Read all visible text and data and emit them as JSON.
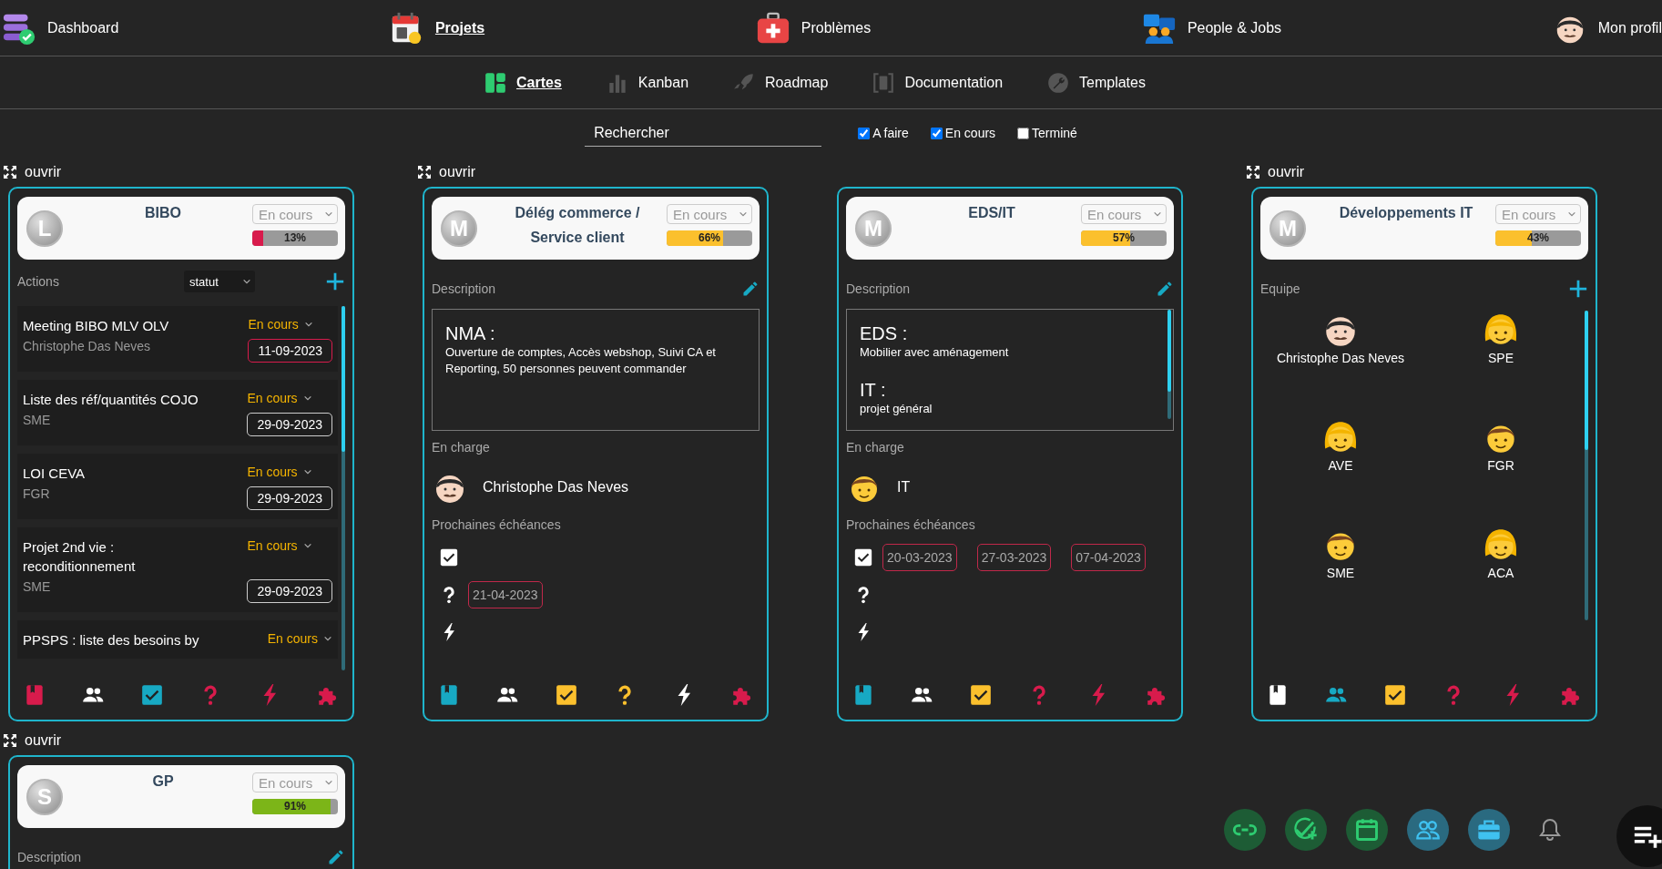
{
  "top_nav": [
    {
      "kind": "dashboard",
      "label": "Dashboard",
      "selected": false
    },
    {
      "kind": "projects",
      "label": "Projets",
      "selected": true
    },
    {
      "kind": "problems",
      "label": "Problèmes",
      "selected": false
    },
    {
      "kind": "people",
      "label": "People & Jobs",
      "selected": false
    },
    {
      "kind": "profile",
      "label": "Mon profil",
      "selected": false
    }
  ],
  "view_tabs": [
    {
      "kind": "cards",
      "label": "Cartes",
      "selected": true
    },
    {
      "kind": "kanban",
      "label": "Kanban",
      "selected": false
    },
    {
      "kind": "roadmap",
      "label": "Roadmap",
      "selected": false
    },
    {
      "kind": "documentation",
      "label": "Documentation",
      "selected": false
    },
    {
      "kind": "templates",
      "label": "Templates",
      "selected": false
    }
  ],
  "search": {
    "placeholder": "Rechercher"
  },
  "filters": [
    {
      "label": "A faire",
      "checked": true
    },
    {
      "label": "En cours",
      "checked": true
    },
    {
      "label": "Terminé",
      "checked": false
    }
  ],
  "projects": [
    {
      "open_label": "ouvrir",
      "logo_letter": "L",
      "title": "BIBO",
      "status": "En cours",
      "progress": {
        "level": 0.13,
        "label": "13%",
        "color": "#d81b4c"
      },
      "kind": "actions",
      "section_label": "Actions",
      "sort": "statut",
      "actions": [
        {
          "title": "Meeting BIBO MLV OLV",
          "owner": "Christophe Das Neves",
          "status": "En cours",
          "date": "11-09-2023",
          "overdue": true
        },
        {
          "title": "Liste des réf/quantités COJO",
          "owner": "SME",
          "status": "En cours",
          "date": "29-09-2023",
          "overdue": false
        },
        {
          "title": "LOI CEVA",
          "owner": "FGR",
          "status": "En cours",
          "date": "29-09-2023",
          "overdue": false
        },
        {
          "title": "Projet 2nd vie : reconditionnement",
          "owner": "SME",
          "status": "En cours",
          "date": "29-09-2023",
          "overdue": false
        },
        {
          "title": "PPSPS : liste des besoins by",
          "status": "En cours"
        }
      ],
      "footer_icons": [
        {
          "kind": "book",
          "color": "#d81b4c"
        },
        {
          "kind": "people",
          "color": "#ffffff"
        },
        {
          "kind": "check",
          "color": "#17a9c3"
        },
        {
          "kind": "question",
          "color": "#d81b4c"
        },
        {
          "kind": "bolt",
          "color": "#d81b4c"
        },
        {
          "kind": "puzzle",
          "color": "#d81b4c"
        }
      ]
    },
    {
      "open_label": "ouvrir",
      "logo_letter": "M",
      "title": "Délég commerce / Service client",
      "status": "En cours",
      "progress": {
        "level": 0.66,
        "label": "66%",
        "color": "#fbc02d"
      },
      "kind": "description",
      "section_label": "Description",
      "description": [
        {
          "heading": "NMA :",
          "text": "Ouverture de comptes, Accès webshop, Suivi CA et Reporting, 50 personnes peuvent commander"
        }
      ],
      "in_charge_label": "En charge",
      "in_charge": {
        "name": "Christophe Das Neves",
        "kind": "man"
      },
      "deadlines_label": "Prochaines échéances",
      "deadlines": [
        {
          "kind": "task"
        },
        {
          "kind": "question",
          "dates": [
            "21-04-2023"
          ]
        },
        {
          "kind": "risk"
        }
      ],
      "footer_icons": [
        {
          "kind": "book",
          "color": "#17a9c3"
        },
        {
          "kind": "people",
          "color": "#ffffff"
        },
        {
          "kind": "check",
          "color": "#fbc02d"
        },
        {
          "kind": "question",
          "color": "#fbc02d"
        },
        {
          "kind": "bolt",
          "color": "#ffffff"
        },
        {
          "kind": "puzzle",
          "color": "#d81b4c"
        }
      ]
    },
    {
      "logo_letter": "M",
      "title": "EDS/IT",
      "status": "En cours",
      "progress": {
        "level": 0.57,
        "label": "57%",
        "color": "#fbc02d"
      },
      "kind": "description",
      "section_label": "Description",
      "description": [
        {
          "heading": "EDS :",
          "text": "Mobilier avec aménagement"
        },
        {
          "heading": "IT :",
          "text": "projet général"
        }
      ],
      "in_charge_label": "En charge",
      "in_charge": {
        "name": "IT",
        "kind": "boy"
      },
      "deadlines_label": "Prochaines échéances",
      "deadlines": [
        {
          "kind": "task",
          "dates": [
            "20-03-2023",
            "27-03-2023",
            "07-04-2023"
          ]
        },
        {
          "kind": "question"
        },
        {
          "kind": "risk"
        }
      ],
      "footer_icons": [
        {
          "kind": "book",
          "color": "#17a9c3"
        },
        {
          "kind": "people",
          "color": "#ffffff"
        },
        {
          "kind": "check",
          "color": "#fbc02d"
        },
        {
          "kind": "question",
          "color": "#d81b4c"
        },
        {
          "kind": "bolt",
          "color": "#d81b4c"
        },
        {
          "kind": "puzzle",
          "color": "#d81b4c"
        }
      ]
    },
    {
      "open_label": "ouvrir",
      "logo_letter": "M",
      "title": "Développements IT",
      "status": "En cours",
      "progress": {
        "level": 0.43,
        "label": "43%",
        "color": "#fbc02d"
      },
      "kind": "team",
      "section_label": "Equipe",
      "members": [
        {
          "name": "Christophe Das Neves",
          "kind": "man"
        },
        {
          "name": "SPE",
          "kind": "girl"
        },
        {
          "name": "AVE",
          "kind": "girl"
        },
        {
          "name": "FGR",
          "kind": "boy"
        },
        {
          "name": "SME",
          "kind": "boy"
        },
        {
          "name": "ACA",
          "kind": "girl"
        }
      ],
      "footer_icons": [
        {
          "kind": "book",
          "color": "#ffffff"
        },
        {
          "kind": "people",
          "color": "#17a9c3"
        },
        {
          "kind": "check",
          "color": "#fbc02d"
        },
        {
          "kind": "question",
          "color": "#d81b4c"
        },
        {
          "kind": "bolt",
          "color": "#d81b4c"
        },
        {
          "kind": "puzzle",
          "color": "#d81b4c"
        }
      ]
    },
    {
      "open_label": "ouvrir",
      "logo_letter": "S",
      "title": "GP",
      "status": "En cours",
      "progress": {
        "level": 0.91,
        "label": "91%",
        "color": "#7cb518"
      },
      "kind": "description",
      "section_label": "Description"
    }
  ]
}
